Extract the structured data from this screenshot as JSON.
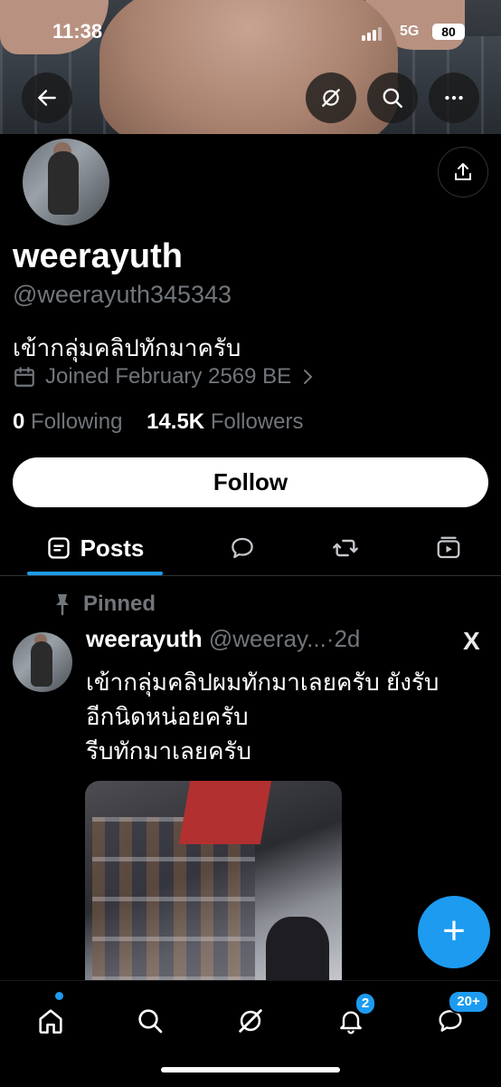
{
  "status_bar": {
    "time": "11:38",
    "network": "5G",
    "battery": "80"
  },
  "header_icons": [
    "back-arrow-icon",
    "grok-icon",
    "search-icon",
    "more-icon"
  ],
  "profile": {
    "name": "weerayuth",
    "handle": "@weerayuth345343",
    "bio": "เข้ากลุ่มคลิปทักมาครับ",
    "joined": "Joined February 2569 BE",
    "following_count": "0",
    "following_label": "Following",
    "followers_count": "14.5K",
    "followers_label": "Followers",
    "follow_button": "Follow"
  },
  "tabs": [
    {
      "label": "Posts",
      "icon": "posts-icon",
      "active": true
    },
    {
      "icon": "replies-icon"
    },
    {
      "icon": "retweet-icon"
    },
    {
      "icon": "media-icon"
    }
  ],
  "pinned_post": {
    "pinned_label": "Pinned",
    "author": "weerayuth",
    "handle": "@weeray...",
    "separator": "·",
    "time": "2d",
    "text_lines": [
      "เข้ากลุ่มคลิปผมทักมาเลยครับ ยังรับ",
      "อีกนิดหน่อยครับ",
      "รีบทักมาเลยครับ"
    ],
    "source_logo": "X"
  },
  "fab": "+",
  "bottom_nav": {
    "items": [
      "home-icon",
      "search-icon",
      "grok-icon",
      "notifications-icon",
      "messages-icon"
    ],
    "notifications_badge": "2",
    "messages_badge": "20+"
  },
  "colors": {
    "accent": "#1d9bf0",
    "background": "#000000",
    "secondary_text": "#71767b"
  }
}
